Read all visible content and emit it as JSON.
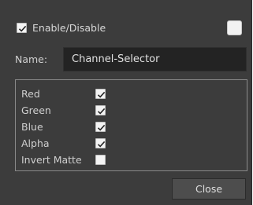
{
  "header": {
    "enable_label": "Enable/Disable",
    "enable_checked": true,
    "color_swatch": "#f2f2f2"
  },
  "name": {
    "label": "Name:",
    "value": "Channel-Selector"
  },
  "channels": [
    {
      "label": "Red",
      "checked": true
    },
    {
      "label": "Green",
      "checked": true
    },
    {
      "label": "Blue",
      "checked": true
    },
    {
      "label": "Alpha",
      "checked": true
    },
    {
      "label": "Invert Matte",
      "checked": false
    }
  ],
  "footer": {
    "close_label": "Close"
  },
  "colors": {
    "background": "#3c3c3c",
    "field": "#232323",
    "button": "#4d4d4d"
  }
}
